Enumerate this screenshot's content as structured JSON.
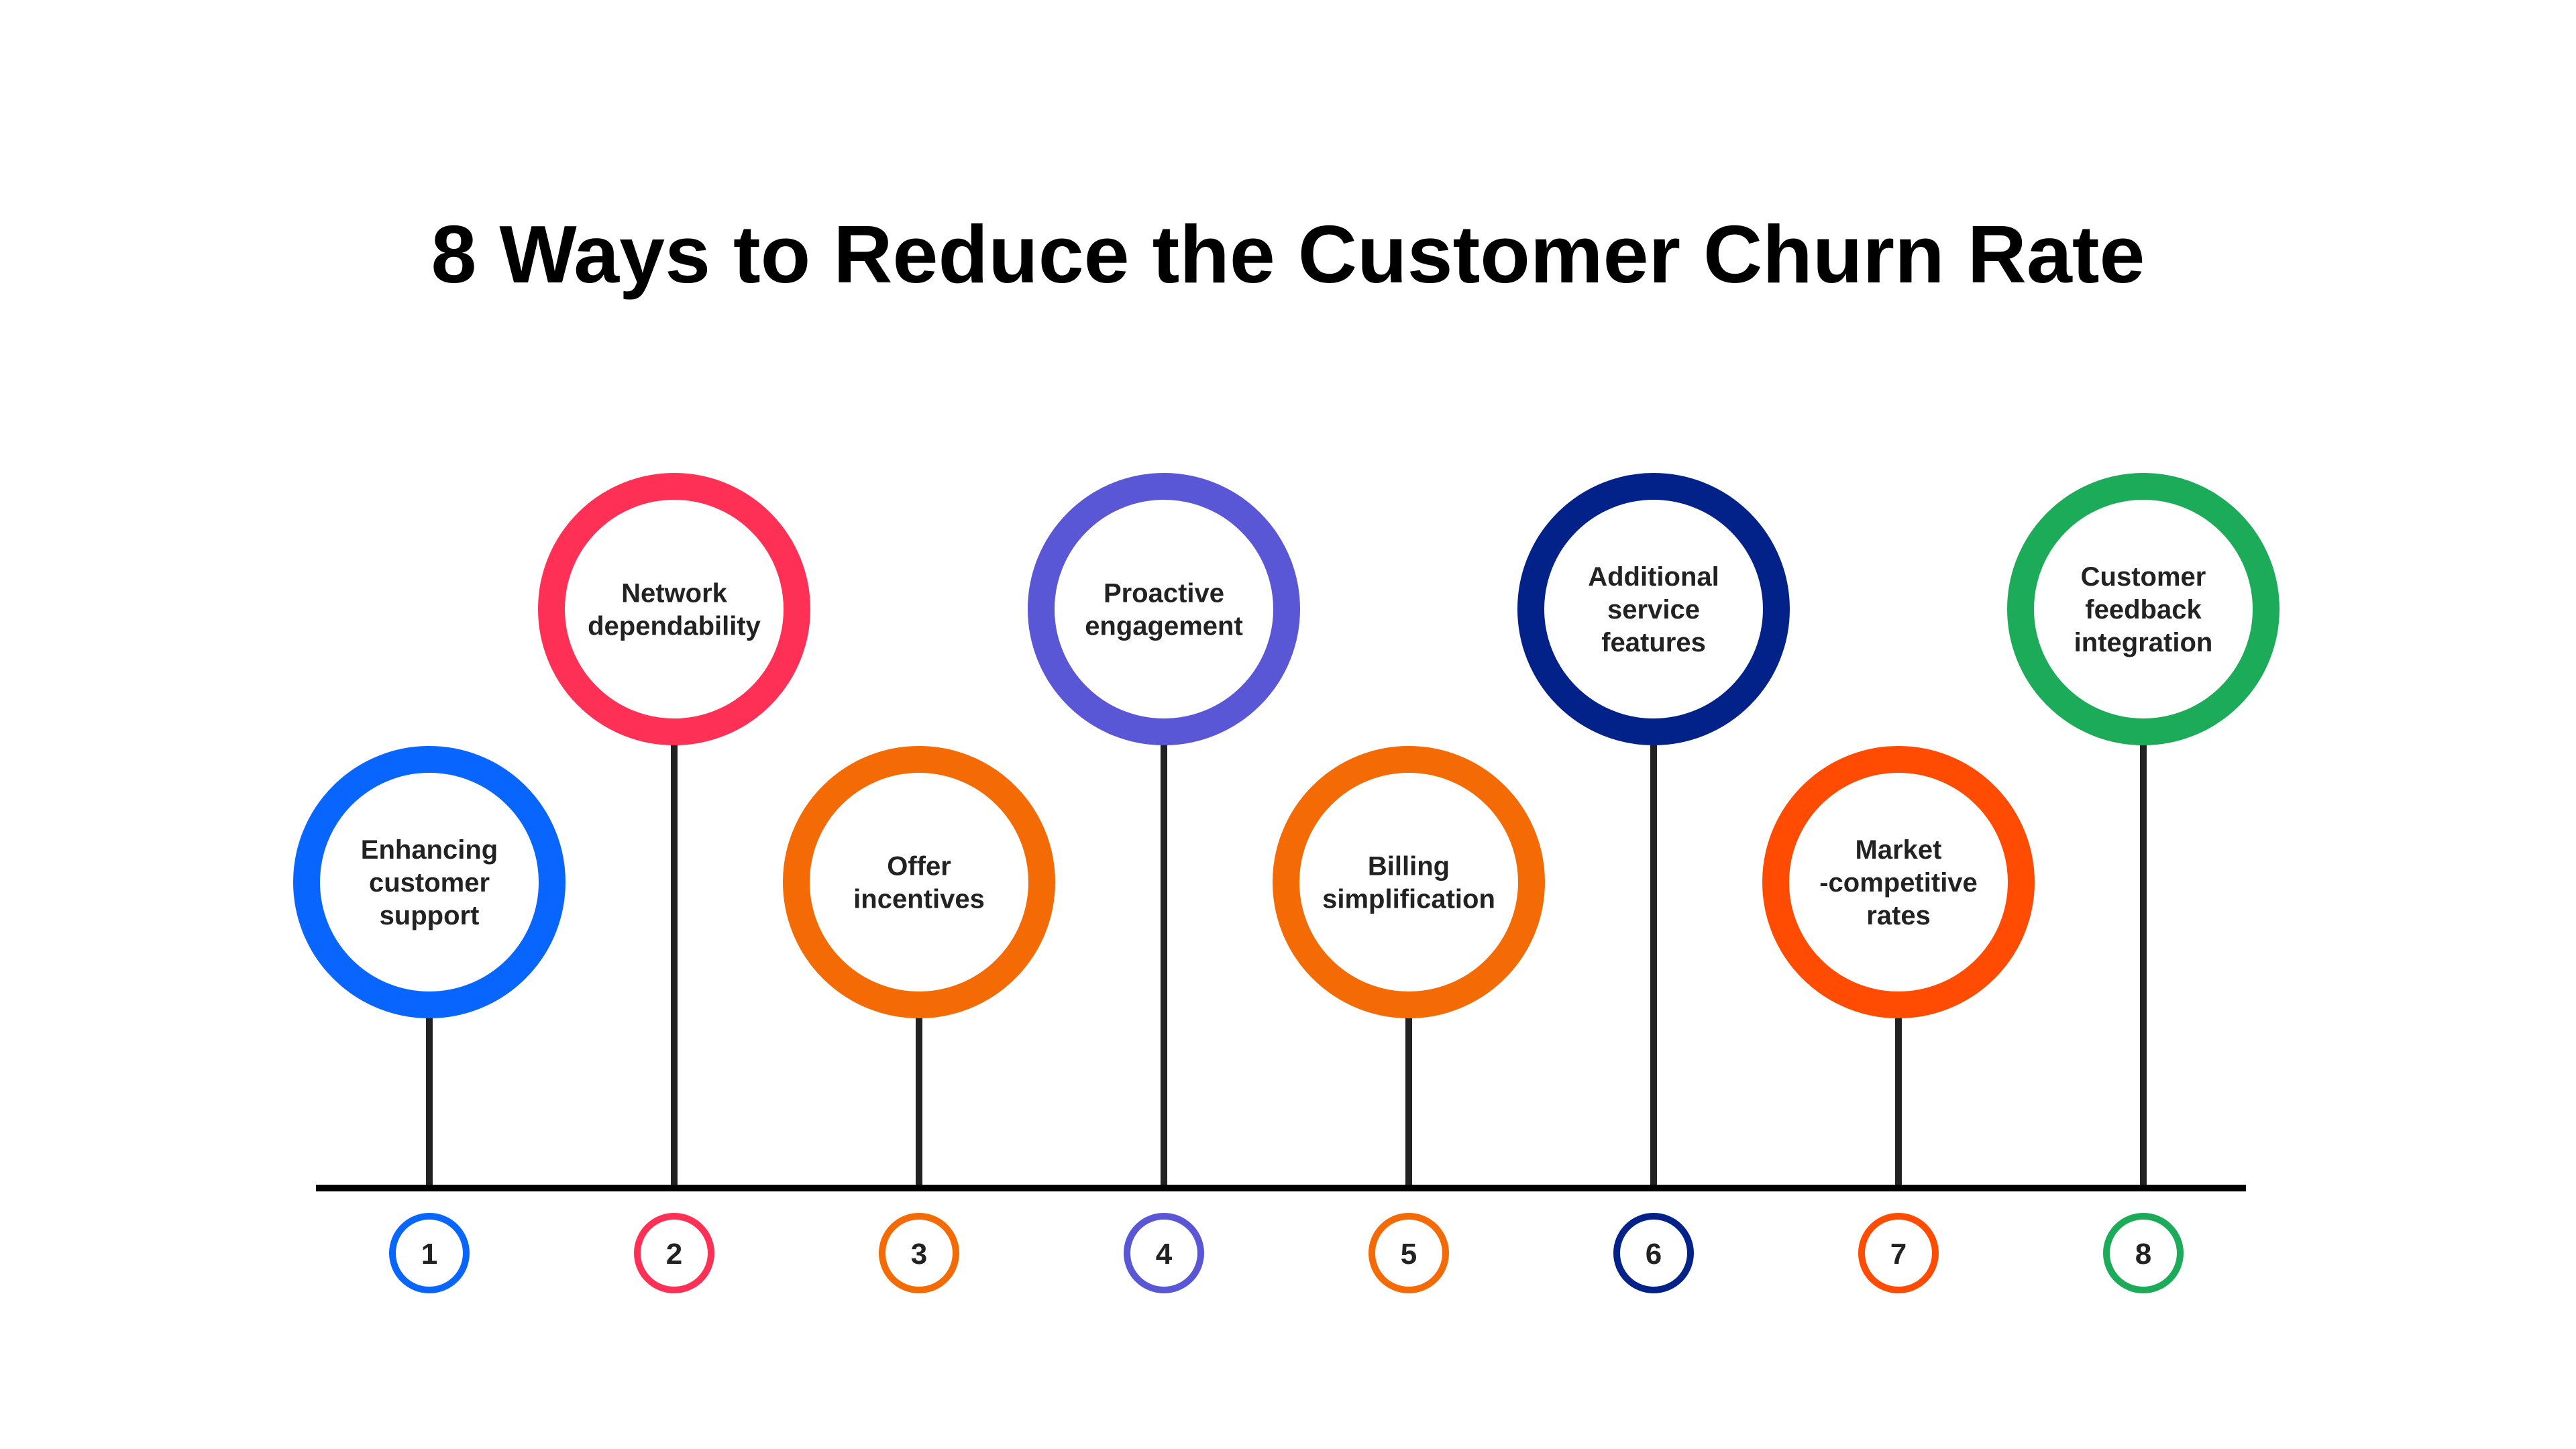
{
  "title": "8 Ways to Reduce the Customer Churn Rate",
  "colors": {
    "text": "#222222",
    "title": "#000000",
    "stem": "#222222",
    "baseline": "#000000",
    "background": "#ffffff"
  },
  "steps": [
    {
      "number": "1",
      "lines": [
        "Enhancing",
        "customer",
        "support"
      ],
      "color": "#0866FF",
      "row": "low"
    },
    {
      "number": "2",
      "lines": [
        "Network",
        "dependability"
      ],
      "color": "#FF3055",
      "row": "high"
    },
    {
      "number": "3",
      "lines": [
        "Offer",
        "incentives"
      ],
      "color": "#F46A04",
      "row": "low"
    },
    {
      "number": "4",
      "lines": [
        "Proactive",
        "engagement"
      ],
      "color": "#5A57D6",
      "row": "high"
    },
    {
      "number": "5",
      "lines": [
        "Billing",
        "simplification"
      ],
      "color": "#F46A04",
      "row": "low"
    },
    {
      "number": "6",
      "lines": [
        "Additional",
        "service",
        "features"
      ],
      "color": "#02228A",
      "row": "high"
    },
    {
      "number": "7",
      "lines": [
        "Market",
        "-competitive",
        "rates"
      ],
      "color": "#FF4C02",
      "row": "low"
    },
    {
      "number": "8",
      "lines": [
        "Customer",
        "feedback",
        "integration"
      ],
      "color": "#1CAB59",
      "row": "high"
    }
  ]
}
